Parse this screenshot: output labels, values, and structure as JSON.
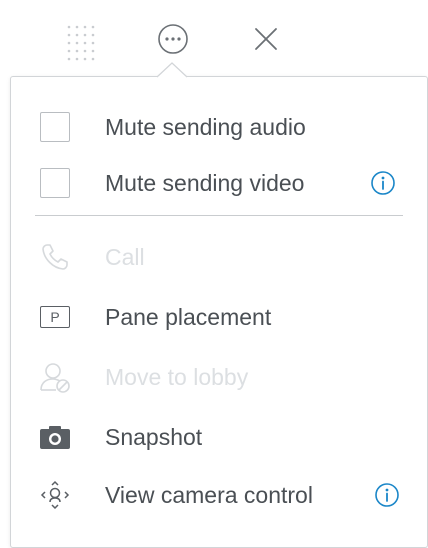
{
  "toolbar": {
    "icons": [
      "grip-dots-icon",
      "more-options-icon",
      "close-icon"
    ]
  },
  "menu": {
    "mute_audio": {
      "label": "Mute sending audio",
      "checked": false
    },
    "mute_video": {
      "label": "Mute sending video",
      "checked": false,
      "info_icon": "info-icon"
    },
    "call": {
      "label": "Call",
      "icon": "phone-icon",
      "enabled": false
    },
    "pane_placement": {
      "label": "Pane placement",
      "icon": "pane-placement-icon",
      "icon_text": "P",
      "enabled": true
    },
    "move_to_lobby": {
      "label": "Move to lobby",
      "icon": "user-lobby-icon",
      "enabled": false
    },
    "snapshot": {
      "label": "Snapshot",
      "icon": "camera-icon",
      "enabled": true
    },
    "camera_control": {
      "label": "View camera control",
      "icon": "camera-control-icon",
      "info_icon": "info-icon",
      "enabled": true
    }
  },
  "colors": {
    "text": "#4a4f54",
    "disabled_text": "#dcdfe2",
    "info_blue": "#1a86c8",
    "border": "#d2d5d8"
  }
}
